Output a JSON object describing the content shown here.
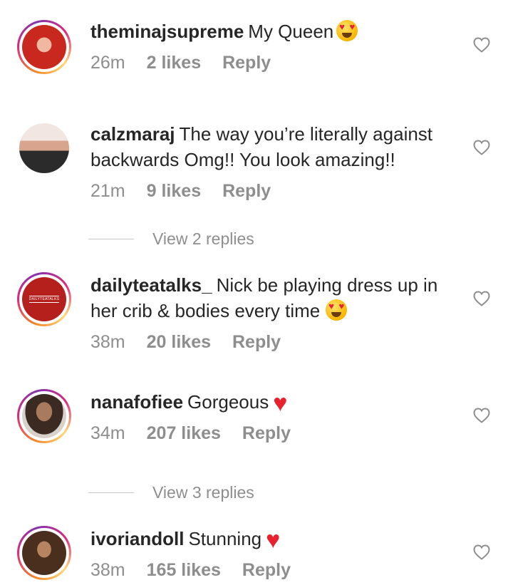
{
  "comments": [
    {
      "username": "theminajsupreme",
      "text": "My Queen",
      "emoji": "smiling-face-with-heart-eyes",
      "time": "26m",
      "likes": "2 likes",
      "reply": "Reply",
      "has_story_ring": true,
      "avatar_color": "#c8281e"
    },
    {
      "username": "calzmaraj",
      "text": "The way you’re literally against backwards Omg!! You look amazing!!",
      "emoji": "",
      "time": "21m",
      "likes": "9 likes",
      "reply": "Reply",
      "has_story_ring": false,
      "avatar_color": "#e9d8d6"
    },
    {
      "username": "dailyteatalks_",
      "text": "Nick be playing dress up in her crib & bodies every time",
      "emoji": "smiling-face-with-heart-eyes",
      "time": "38m",
      "likes": "20 likes",
      "reply": "Reply",
      "has_story_ring": true,
      "avatar_color": "#b5201c",
      "avatar_text": "DAILYTEATALKS"
    },
    {
      "username": "nanafofiee",
      "text": "Gorgeous",
      "emoji": "red-heart",
      "time": "34m",
      "likes": "207 likes",
      "reply": "Reply",
      "has_story_ring": true,
      "avatar_color": "#7a5a48"
    },
    {
      "username": "ivoriandoll",
      "text": "Stunning",
      "emoji": "red-heart",
      "time": "38m",
      "likes": "165 likes",
      "reply": "Reply",
      "has_story_ring": true,
      "avatar_color": "#6b4a34"
    }
  ],
  "view_replies": [
    {
      "label": "View 2 replies"
    },
    {
      "label": "View 3 replies"
    }
  ],
  "icons": {
    "like": "heart-outline-icon"
  },
  "colors": {
    "text": "#262626",
    "secondary": "#8e8e8e",
    "heart_emoji": "#e8212f"
  }
}
